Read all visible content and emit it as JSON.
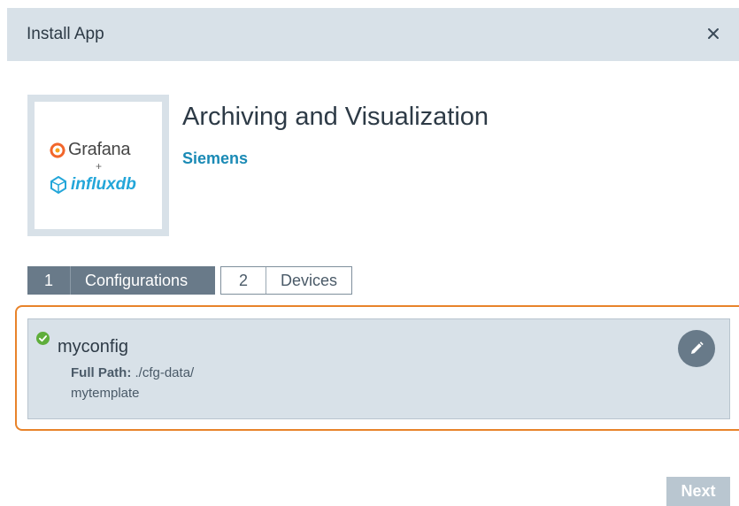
{
  "dialog": {
    "title": "Install App",
    "close_icon": "close-icon"
  },
  "app": {
    "name": "Archiving and Visualization",
    "vendor": "Siemens",
    "logo": {
      "grafana_text": "Grafana",
      "plus": "+",
      "influx_text": "influxdb",
      "grafana_color": "#f2662b",
      "influx_color": "#23a6d9"
    }
  },
  "steps": [
    {
      "number": "1",
      "label": "Configurations",
      "active": true
    },
    {
      "number": "2",
      "label": "Devices",
      "active": false
    }
  ],
  "configuration": {
    "name": "myconfig",
    "status_icon": "check-circle-icon",
    "status_color": "#5fae3b",
    "path_label": "Full Path:",
    "path_value": "./cfg-data/",
    "path_value_line2": "mytemplate",
    "edit_icon": "pencil-icon"
  },
  "footer": {
    "next_label": "Next"
  },
  "colors": {
    "header_bg": "#d8e1e8",
    "accent": "#697a89",
    "highlight": "#e8832a",
    "vendor_link": "#1a8ab5"
  }
}
